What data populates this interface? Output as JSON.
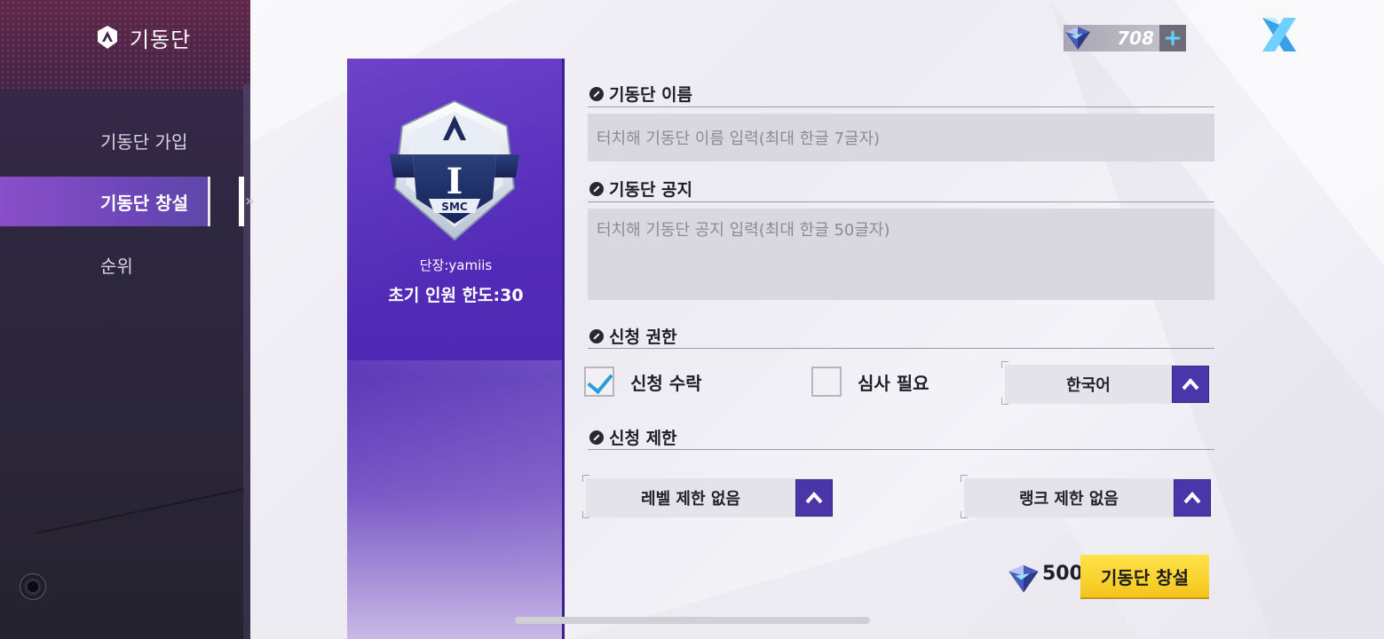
{
  "sidebar": {
    "title": "기동단",
    "items": [
      {
        "label": "기동단 가입",
        "active": false
      },
      {
        "label": "기동단 창설",
        "active": true
      },
      {
        "label": "순위",
        "active": false
      }
    ]
  },
  "banner": {
    "emblem_letter": "I",
    "emblem_tag": "SMC",
    "leader": "단장:yamiis",
    "member_limit": "초기 인원 한도:30"
  },
  "currency": {
    "amount": "708",
    "plus": "+"
  },
  "form": {
    "name_section": "기동단 이름",
    "name_placeholder": "터치해 기동단 이름 입력(최대 한글 7글자)",
    "notice_section": "기동단 공지",
    "notice_placeholder": "터치해 기동단 공지 입력(최대 한글 50글자)",
    "permission_section": "신청 권한",
    "accept_label": "신청 수락",
    "accept_checked": true,
    "review_label": "심사 필요",
    "review_checked": false,
    "language_value": "한국어",
    "restriction_section": "신청 제한",
    "level_value": "레벨 제한 없음",
    "rank_value": "랭크 제한 없음"
  },
  "footer": {
    "cost": "500",
    "create_label": "기동단 창설"
  },
  "colors": {
    "accent": "#4a36a8",
    "banner": "#5b2fc2",
    "create_button": "#f9d632",
    "check": "#2c9ad8"
  }
}
